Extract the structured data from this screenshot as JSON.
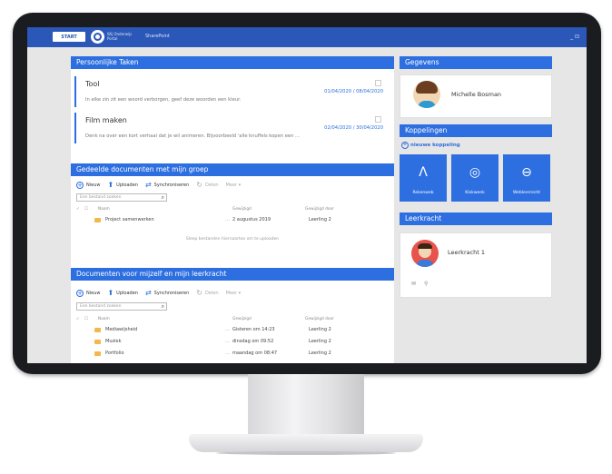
{
  "topbar": {
    "start": "START",
    "brand": "Wij Onderwijs Portal",
    "title": "SharePoint",
    "controls": "_ ⊡"
  },
  "tasks": {
    "header": "Persoonlijke Taken",
    "items": [
      {
        "title": "Tool",
        "date": "01/04/2020 / 08/04/2020",
        "desc": "In elke zin zit een woord verborgen, geef deze woorden een kleur."
      },
      {
        "title": "Film maken",
        "date": "02/04/2020 / 30/04/2020",
        "desc": "Denk na over een kort verhaal dat je wil animeren. Bijvoorbeeld 'alle knuffels kopen een ..."
      }
    ]
  },
  "toolbar": {
    "new": "Nieuw",
    "upload": "Uploaden",
    "sync": "Synchroniseren",
    "delete": "Delen",
    "more": "Meer ▾"
  },
  "shared": {
    "header": "Gedeelde documenten met mijn groep",
    "search_placeholder": "Een bestand zoeken",
    "columns": {
      "name": "Naam",
      "modified": "Gewijzigd",
      "by": "Gewijzigd door"
    },
    "rows": [
      {
        "name": "Project samenwerken",
        "modified": "2 augustus 2019",
        "by": "Leerling 2"
      }
    ],
    "hint": "Sleep bestanden hiernaartoe om te uploaden"
  },
  "mine": {
    "header": "Documenten voor mijzelf en mijn leerkracht",
    "search_placeholder": "Een bestand zoeken",
    "columns": {
      "name": "Naam",
      "modified": "Gewijzigd",
      "by": "Gewijzigd door"
    },
    "rows": [
      {
        "name": "Mediawijsheid",
        "modified": "Gisteren om 14:23",
        "by": "Leerling 2"
      },
      {
        "name": "Muziek",
        "modified": "dinsdag om 09:52",
        "by": "Leerling 2"
      },
      {
        "name": "Portfolio",
        "modified": "maandag om 08:47",
        "by": "Leerling 2"
      }
    ]
  },
  "gegevens": {
    "header": "Gegevens",
    "name": "Michelle Bosman"
  },
  "koppelingen": {
    "header": "Koppelingen",
    "add": "nieuwe koppeling",
    "tiles": [
      {
        "icon": "Λ",
        "label": "Rekenweb"
      },
      {
        "icon": "◎",
        "label": "Klokweek"
      },
      {
        "icon": "⊖",
        "label": "Webleerrecht"
      }
    ]
  },
  "leerkracht": {
    "header": "Leerkracht",
    "name": "Leerkracht 1"
  }
}
